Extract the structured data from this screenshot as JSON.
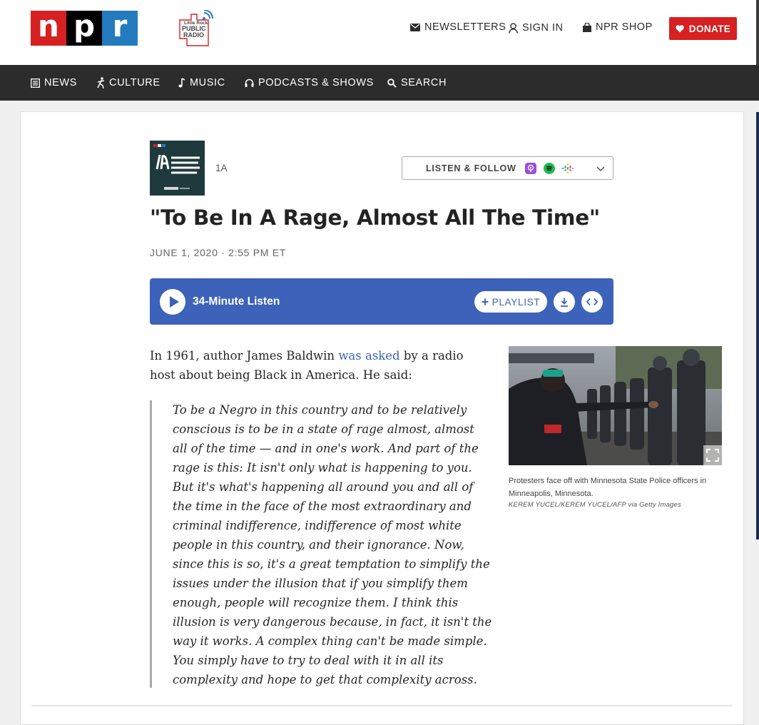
{
  "header": {
    "npr_letters": [
      "n",
      "p",
      "r"
    ],
    "station_logo_text": "Little Rock PUBLIC RADIO",
    "newsletters_label": "NEWSLETTERS",
    "sign_in_label": "SIGN IN",
    "shop_label": "NPR SHOP",
    "donate_label": "DONATE",
    "brand_colors": {
      "red": "#d62021",
      "black": "#000000",
      "blue": "#237bbd"
    }
  },
  "nav": {
    "items": [
      {
        "label": "NEWS",
        "icon": "news-icon"
      },
      {
        "label": "CULTURE",
        "icon": "culture-icon"
      },
      {
        "label": "MUSIC",
        "icon": "music-note-icon"
      },
      {
        "label": "PODCASTS & SHOWS",
        "icon": "headphones-icon"
      },
      {
        "label": "SEARCH",
        "icon": "search-icon"
      }
    ]
  },
  "article": {
    "show_name": "1A",
    "listen_follow_label": "LISTEN & FOLLOW",
    "listen_follow_icons": [
      "apple-podcasts-icon",
      "spotify-icon",
      "google-podcasts-icon"
    ],
    "headline": "\"To Be In A Rage, Almost All The Time\"",
    "dateline": "JUNE 1, 2020 · 2:55 PM ET",
    "player": {
      "listen_label": "34-Minute Listen",
      "playlist_label": "PLAYLIST",
      "accent_color": "#3d62b9"
    },
    "intro_before_link": "In 1961, author James Baldwin ",
    "intro_link": "was asked",
    "intro_after_link": " by a radio host about being Black in America. He said:",
    "quote": "To be a Negro in this country and to be relatively conscious is to be in a state of rage almost, almost all of the time — and in one's work. And part of the rage is this: It isn't only what is happening to you. But it's what's happening all around you and all of the time in the face of the most extraordinary and criminal indifference, indifference of most white people in this country, and their ignorance. Now, since this is so, it's a great temptation to simplify the issues under the illusion that if you simplify them enough, people will recognize them. I think this illusion is very dangerous because, in fact, it isn't the way it works. A complex thing can't be made simple. You simply have to try to deal with it in all its complexity and hope to get that complexity across.",
    "photo": {
      "caption": "Protesters face off with Minnesota State Police officers in Minneapolis, Minnesota.",
      "credit": "KEREM YUCEL/KEREM YUCEL/AFP via Getty Images"
    }
  }
}
